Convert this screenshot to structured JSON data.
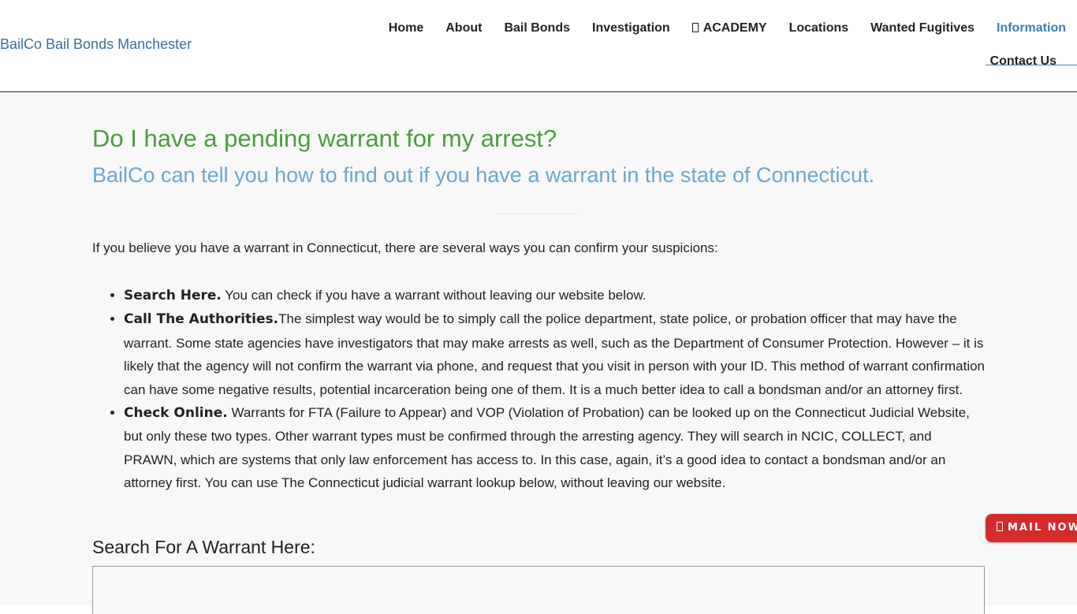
{
  "header": {
    "logo_alt": "BailCo Bail Bonds Manchester",
    "nav": [
      {
        "label": "Home"
      },
      {
        "label": "About"
      },
      {
        "label": "Bail Bonds"
      },
      {
        "label": "Investigation"
      },
      {
        "label": "ACADEMY"
      },
      {
        "label": "Locations"
      },
      {
        "label": "Wanted Fugitives"
      },
      {
        "label": "Information"
      }
    ],
    "nav_second_row": {
      "label": "Contact Us"
    },
    "active_item": "Information",
    "active_color": "#3b7bbf"
  },
  "page": {
    "title": "Do I have a pending warrant for my arrest?",
    "subtitle": "BailCo can tell you how to find out if you have a warrant in the state of Connecticut.",
    "intro": "If you believe you have a warrant in Connecticut, there are several ways you can confirm your suspicions:",
    "ways": [
      {
        "lead": "Search Here.",
        "text": " You can check if you have a warrant without leaving our website below."
      },
      {
        "lead": "Call The Authorities.",
        "text": "The simplest way would be to simply call the police department, state police, or probation officer that may have the warrant. Some state agencies have investigators that may make arrests as well, such as the Department of Consumer Protection. However – it is likely that the agency will not confirm the warrant via phone, and request that you visit in person with your ID. This method of warrant confirmation can have some negative results, potential incarceration being one of them. It is a much better idea to call a bondsman and/or an attorney first."
      },
      {
        "lead": "Check Online.",
        "text": " Warrants for FTA (Failure to Appear) and VOP (Violation of Probation) can be looked up on the Connecticut Judicial Website, but only these two types. Other warrant types must be confirmed through the arresting agency. They will search in NCIC, COLLECT, and PRAWN, which are systems that only law enforcement has access to. In this case, again, it’s a good idea to contact a bondsman and/or an attorney first. You can use The Connecticut judicial warrant lookup below, without leaving our website."
      }
    ],
    "search_heading": "Search For A Warrant Here:"
  },
  "floating": {
    "mail_now_label": "MAIL NOW",
    "mail_now_color": "#d62b2b"
  },
  "colors": {
    "title": "#4a9e3c",
    "subtitle": "#6aa8cd"
  }
}
